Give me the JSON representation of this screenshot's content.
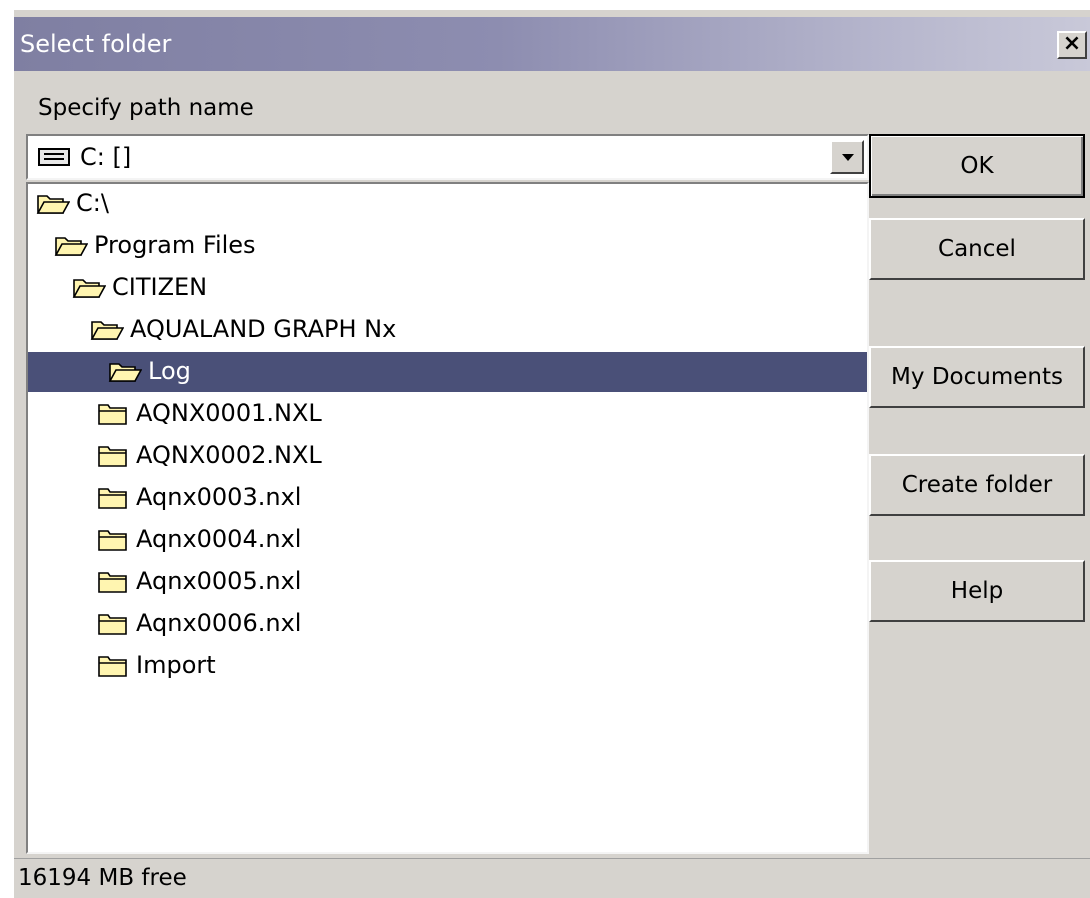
{
  "window": {
    "title": "Select folder",
    "close_label": "×"
  },
  "path_label": "Specify path name",
  "drive_combo": {
    "value": "C: []",
    "icon": "drive-icon"
  },
  "tree": {
    "items": [
      {
        "label": "C:\\",
        "icon": "open-folder-icon",
        "level": 0,
        "selected": false
      },
      {
        "label": "Program Files",
        "icon": "open-folder-icon",
        "level": 1,
        "selected": false
      },
      {
        "label": "CITIZEN",
        "icon": "open-folder-icon",
        "level": 2,
        "selected": false
      },
      {
        "label": "AQUALAND GRAPH Nx",
        "icon": "open-folder-icon",
        "level": 3,
        "selected": false
      },
      {
        "label": "Log",
        "icon": "open-folder-icon",
        "level": 4,
        "selected": true
      },
      {
        "label": "AQNX0001.NXL",
        "icon": "closed-folder-icon",
        "level": 5,
        "selected": false
      },
      {
        "label": "AQNX0002.NXL",
        "icon": "closed-folder-icon",
        "level": 5,
        "selected": false
      },
      {
        "label": "Aqnx0003.nxl",
        "icon": "closed-folder-icon",
        "level": 5,
        "selected": false
      },
      {
        "label": "Aqnx0004.nxl",
        "icon": "closed-folder-icon",
        "level": 5,
        "selected": false
      },
      {
        "label": "Aqnx0005.nxl",
        "icon": "closed-folder-icon",
        "level": 5,
        "selected": false
      },
      {
        "label": "Aqnx0006.nxl",
        "icon": "closed-folder-icon",
        "level": 5,
        "selected": false
      },
      {
        "label": "Import",
        "icon": "closed-folder-icon",
        "level": 5,
        "selected": false
      }
    ]
  },
  "buttons": {
    "ok": "OK",
    "cancel": "Cancel",
    "my_documents": "My Documents",
    "create_folder": "Create folder",
    "help": "Help"
  },
  "status": {
    "free_space": "16194 MB free"
  },
  "colors": {
    "selection": "#4a5078",
    "folder_fill": "#fff5b0",
    "dialog_face": "#d6d3ce"
  }
}
